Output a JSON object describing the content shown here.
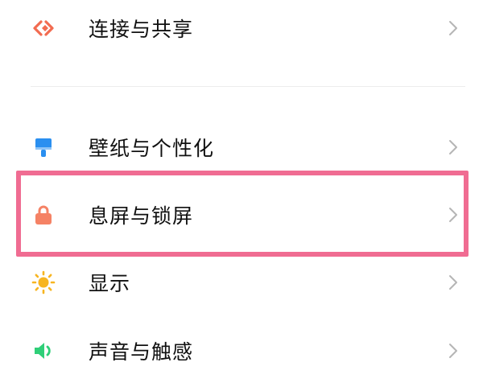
{
  "settings": {
    "items": [
      {
        "label": "连接与共享",
        "icon": "connection-share-icon",
        "icon_color": "#f26b50"
      },
      {
        "label": "壁纸与个性化",
        "icon": "wallpaper-brush-icon",
        "icon_color": "#2a8ff0"
      },
      {
        "label": "息屏与锁屏",
        "icon": "lock-icon",
        "icon_color": "#f58265"
      },
      {
        "label": "显示",
        "icon": "sun-icon",
        "icon_color": "#f7b521"
      },
      {
        "label": "声音与触感",
        "icon": "speaker-icon",
        "icon_color": "#2fcf78"
      }
    ]
  },
  "highlight_color": "#f06c92"
}
